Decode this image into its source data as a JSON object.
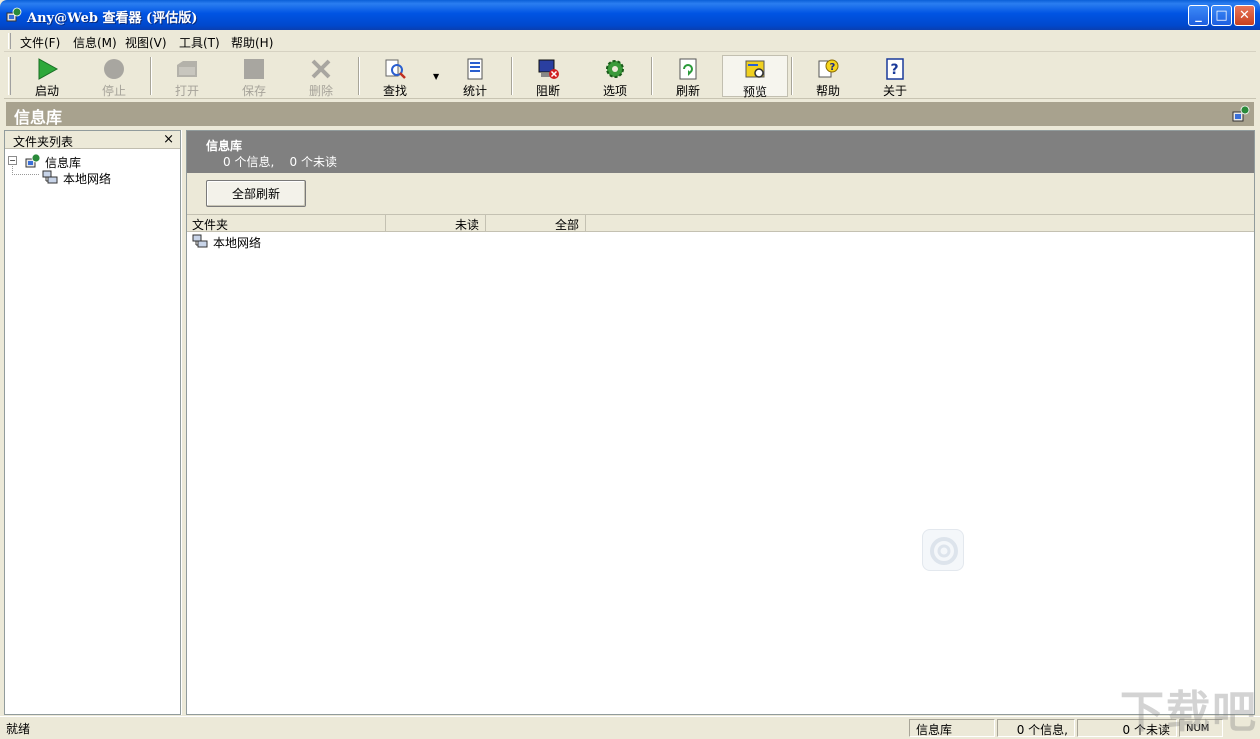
{
  "window": {
    "title": "Any@Web 查看器 (评估版)",
    "buttons": {
      "minimize": "_",
      "maximize": "□",
      "close": "✕"
    }
  },
  "menu": [
    "文件(F)",
    "信息(M)",
    "视图(V)",
    "工具(T)",
    "帮助(H)"
  ],
  "toolbar": {
    "start": "启动",
    "stop": "停止",
    "open": "打开",
    "save": "保存",
    "delete": "删除",
    "find": "查找",
    "stats": "统计",
    "block": "阻断",
    "options": "选项",
    "refresh": "刷新",
    "preview": "预览",
    "help": "帮助",
    "about": "关于"
  },
  "header": {
    "title": "信息库"
  },
  "folder_pane": {
    "title": "文件夹列表",
    "close": "×",
    "tree": [
      {
        "label": "信息库",
        "expander": "−"
      },
      {
        "label": "本地网络"
      }
    ]
  },
  "info_panel": {
    "title": "信息库",
    "counts": "0 个信息,    0 个未读",
    "refresh_all": "全部刷新"
  },
  "list": {
    "columns": [
      "文件夹",
      "未读",
      "全部"
    ],
    "rows": [
      {
        "folder": "本地网络"
      }
    ]
  },
  "status": {
    "main": "就绪",
    "db": "信息库",
    "messages": "0 个信息,",
    "unread": "0 个未读",
    "num": "NUM"
  },
  "watermark": "下载吧",
  "colors": {
    "titlebar": "#0054e3",
    "chrome": "#ece9d8",
    "header_band": "#a8a28e",
    "info_head": "#808080"
  }
}
